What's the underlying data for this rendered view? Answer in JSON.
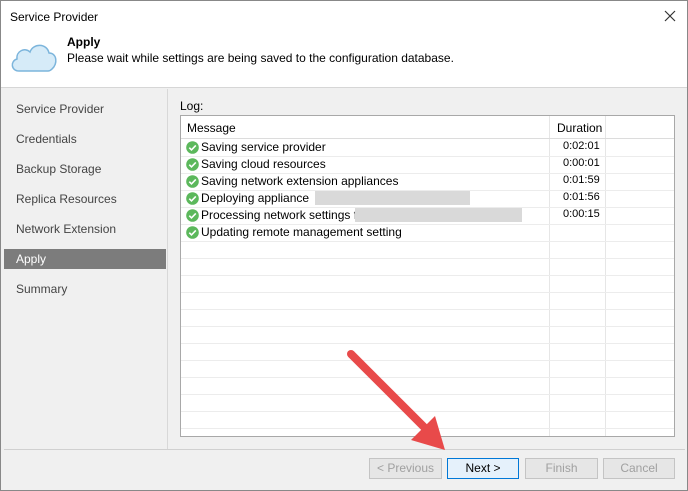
{
  "window": {
    "title": "Service Provider"
  },
  "header": {
    "title": "Apply",
    "subtitle": "Please wait while settings are being saved to the configuration database."
  },
  "sidebar": {
    "items": [
      {
        "label": "Service Provider",
        "active": false
      },
      {
        "label": "Credentials",
        "active": false
      },
      {
        "label": "Backup Storage",
        "active": false
      },
      {
        "label": "Replica Resources",
        "active": false
      },
      {
        "label": "Network Extension",
        "active": false
      },
      {
        "label": "Apply",
        "active": true
      },
      {
        "label": "Summary",
        "active": false
      }
    ]
  },
  "log": {
    "label": "Log:",
    "columns": {
      "message": "Message",
      "duration": "Duration"
    },
    "rows": [
      {
        "message": "Saving service provider",
        "duration": "0:02:01",
        "status": "success"
      },
      {
        "message": "Saving cloud resources",
        "duration": "0:00:01",
        "status": "success"
      },
      {
        "message": "Saving network extension appliances",
        "duration": "0:01:59",
        "status": "success"
      },
      {
        "message": "Deploying appliance",
        "duration": "0:01:56",
        "status": "success"
      },
      {
        "message": "Processing network settings for",
        "duration": "0:00:15",
        "status": "success"
      },
      {
        "message": "Updating remote management setting",
        "duration": "",
        "status": "success"
      }
    ]
  },
  "buttons": {
    "previous": "< Previous",
    "next": "Next >",
    "finish": "Finish",
    "cancel": "Cancel"
  },
  "colors": {
    "success": "#5cb85c",
    "arrow": "#e84a4a",
    "active_nav": "#7c7c7c"
  },
  "icons": {
    "close": "close-icon",
    "cloud": "cloud-icon",
    "check": "check-circle-icon",
    "arrow": "annotation-arrow"
  }
}
